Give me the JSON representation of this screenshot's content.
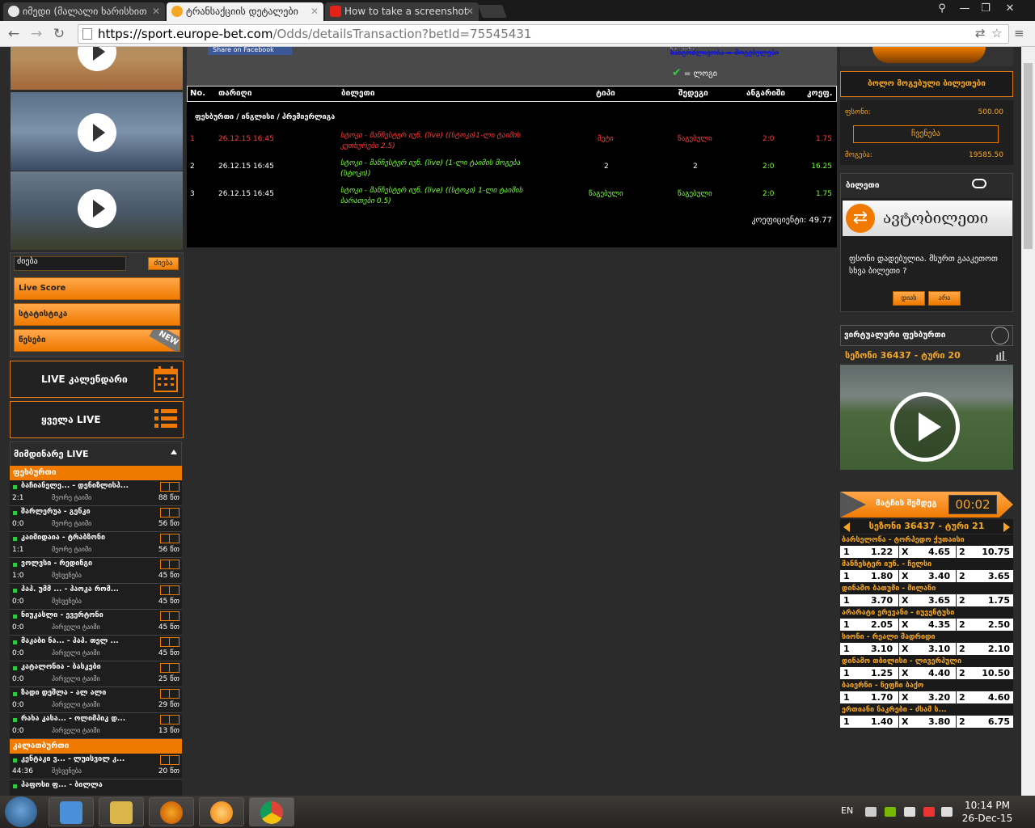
{
  "browser": {
    "tabs": [
      {
        "title": "იმედი (მალალი ხარისხით",
        "favicon_color": "#e8e8e8"
      },
      {
        "title": "ტრანსაქციის დეტალები",
        "favicon_color": "#f5a623"
      },
      {
        "title": "How to take a screenshot",
        "favicon_color": "#e62117"
      }
    ],
    "url_host": "https://sport.europe-bet.com",
    "url_path": "/Odds/detailsTransaction?betId=75545431"
  },
  "left": {
    "search_placeholder": "ძიება",
    "search_button": "ძიება",
    "menu": [
      "Live Score",
      "სტატისტიკა",
      "წესები"
    ],
    "new_badge": "NEW",
    "live_calendar": "LIVE კალენდარი",
    "all_live": "ყველა LIVE",
    "current_live": "მიმდინარე LIVE",
    "sports": [
      {
        "name": "ფეხბურთი",
        "matches": [
          {
            "teams": "ბაჩიანელე... - დენიზლისპ...",
            "score": "2:1",
            "status": "მეორე ტაიმი",
            "minute": "88 წთ"
          },
          {
            "teams": "შარლერუა - გენკი",
            "score": "0:0",
            "status": "მეორე ტაიმი",
            "minute": "56 წთ"
          },
          {
            "teams": "კაიმიდაია - ტრაბზონი",
            "score": "1:1",
            "status": "მეორე ტაიმი",
            "minute": "56 წთ"
          },
          {
            "teams": "ვოლვსი - რედინგი",
            "score": "1:0",
            "status": "შესვენება",
            "minute": "45 წთ"
          },
          {
            "teams": "პაპ. უმმ ... - პაოკა რომ...",
            "score": "0:0",
            "status": "შესვენება",
            "minute": "45 წთ"
          },
          {
            "teams": "ნიუკასლი - ევერტონი",
            "score": "0:0",
            "status": "პირველი ტაიმი",
            "minute": "45 წთ"
          },
          {
            "teams": "მაკაბი ნა... - პაპ. თელ ...",
            "score": "0:0",
            "status": "პირველი ტაიმი",
            "minute": "45 წთ"
          },
          {
            "teams": "კატალონია - ბასკები",
            "score": "0:0",
            "status": "პირველი ტაიმი",
            "minute": "25 წთ"
          },
          {
            "teams": "ზადი დეშლა - ალ ალი",
            "score": "0:0",
            "status": "პირველი ტაიმი",
            "minute": "29 წთ"
          },
          {
            "teams": "რახა კასა... - ოლიმპიკ დ...",
            "score": "0:0",
            "status": "პირველი ტაიმი",
            "minute": "13 წთ"
          }
        ]
      },
      {
        "name": "კალათბურთი",
        "matches": [
          {
            "teams": "კენტაკი ვ... - ლუისვილ კ...",
            "score": "44:36",
            "status": "შესვენება",
            "minute": "20 წთ"
          },
          {
            "teams": "პაფოსი ფ... - ბილლა",
            "score": "",
            "status": "",
            "minute": ""
          }
        ]
      }
    ]
  },
  "center": {
    "share_button": "Share on Facebook",
    "status_top": "სტატუსი - ...",
    "status_strike": "ხანგრძლივობა = მოგებულები",
    "status_ok": "= ლოგი",
    "columns": [
      "No.",
      "თარიღი",
      "ბილეთი",
      "ტიპი",
      "შედეგი",
      "ანგარიში",
      "კოეფ."
    ],
    "league": "ფეხბურთი / ინგლისი / პრემიერლიგა",
    "rows": [
      {
        "no": "1",
        "date": "26.12.15 16:45",
        "bet_line1": "სტოკი - მანჩესტერ იუნ. (live) ((სტოკი)1-ლი ტაიმის",
        "bet_line2": "კუთხურები 2.5)",
        "type": "მეტი",
        "result": "წაგებული",
        "score": "2:0",
        "coef": "1.75",
        "color": "red"
      },
      {
        "no": "2",
        "date": "26.12.15 16:45",
        "bet_line1": "სტოკი - მანჩესტერ იუნ. (live) (1-ლი ტაიმის მოგება",
        "bet_line2": "(სტოკი))",
        "type": "2",
        "result": "2",
        "score": "2:0",
        "coef": "16.25",
        "color": "green"
      },
      {
        "no": "3",
        "date": "26.12.15 16:45",
        "bet_line1": "სტოკი - მანჩესტერ იუნ. (live) ((სტოკი) 1-ლი ტაიმის",
        "bet_line2": "ბარათები 0.5)",
        "type": "წაგებული",
        "result": "წაგებული",
        "score": "2:0",
        "coef": "1.75",
        "color": "green"
      }
    ],
    "total_coef": "კოეფიციენტი: 49.77"
  },
  "right": {
    "recent_tickets": "ბოლო მოგებული ბილეთები",
    "stake_label": "ფსონი:",
    "stake_value": "500.00",
    "show_button": "ჩვენება",
    "win_label": "მოგება:",
    "win_value": "19585.50",
    "ticket_title": "ბილეთი",
    "auto_ticket": "ავტობილეთი",
    "auto_text": "ფსონი დადებულია. მსურთ გააკეთოთ სხვა ბილეთი ?",
    "yes": "დიახ",
    "no": "არა",
    "virtual_title": "ვირტუალური ფეხბურთი",
    "season1": "სეზონი 36437 - ტური 20",
    "until_label": "მატჩის შემდეგ",
    "until_time": "00:02",
    "season2": "სეზონი 36437 - ტური 21",
    "odds": [
      {
        "match": "ბარსელონა - ტორპედო ქუთაისი",
        "h": "1.22",
        "d": "4.65",
        "a": "10.75"
      },
      {
        "match": "მანჩესტერ იუნ. - ჩელსი",
        "h": "1.80",
        "d": "3.40",
        "a": "3.65"
      },
      {
        "match": "დინამო ბათუმი - მილანი",
        "h": "3.70",
        "d": "3.65",
        "a": "1.75"
      },
      {
        "match": "არარატი ერევანი - იუვენტუსი",
        "h": "2.05",
        "d": "4.35",
        "a": "2.50"
      },
      {
        "match": "სიონი - რეალი მადრიდი",
        "h": "3.10",
        "d": "3.10",
        "a": "2.10"
      },
      {
        "match": "დინამო თბილისი - ლივერპული",
        "h": "1.25",
        "d": "4.40",
        "a": "10.50"
      },
      {
        "match": "ბაიერნი - ნეფჩი ბაქო",
        "h": "1.70",
        "d": "3.20",
        "a": "4.60"
      },
      {
        "match": "ერთიანი ნაკრები - ძსამ ს...",
        "h": "1.40",
        "d": "3.80",
        "a": "6.75"
      }
    ],
    "odds_labels": {
      "one": "1",
      "x": "X",
      "two": "2"
    }
  },
  "taskbar": {
    "lang": "EN",
    "time": "10:14 PM",
    "date": "26-Dec-15"
  },
  "colors": {
    "accent": "#f07a00",
    "loss": "#ff3b3b",
    "win": "#7cff3b"
  }
}
